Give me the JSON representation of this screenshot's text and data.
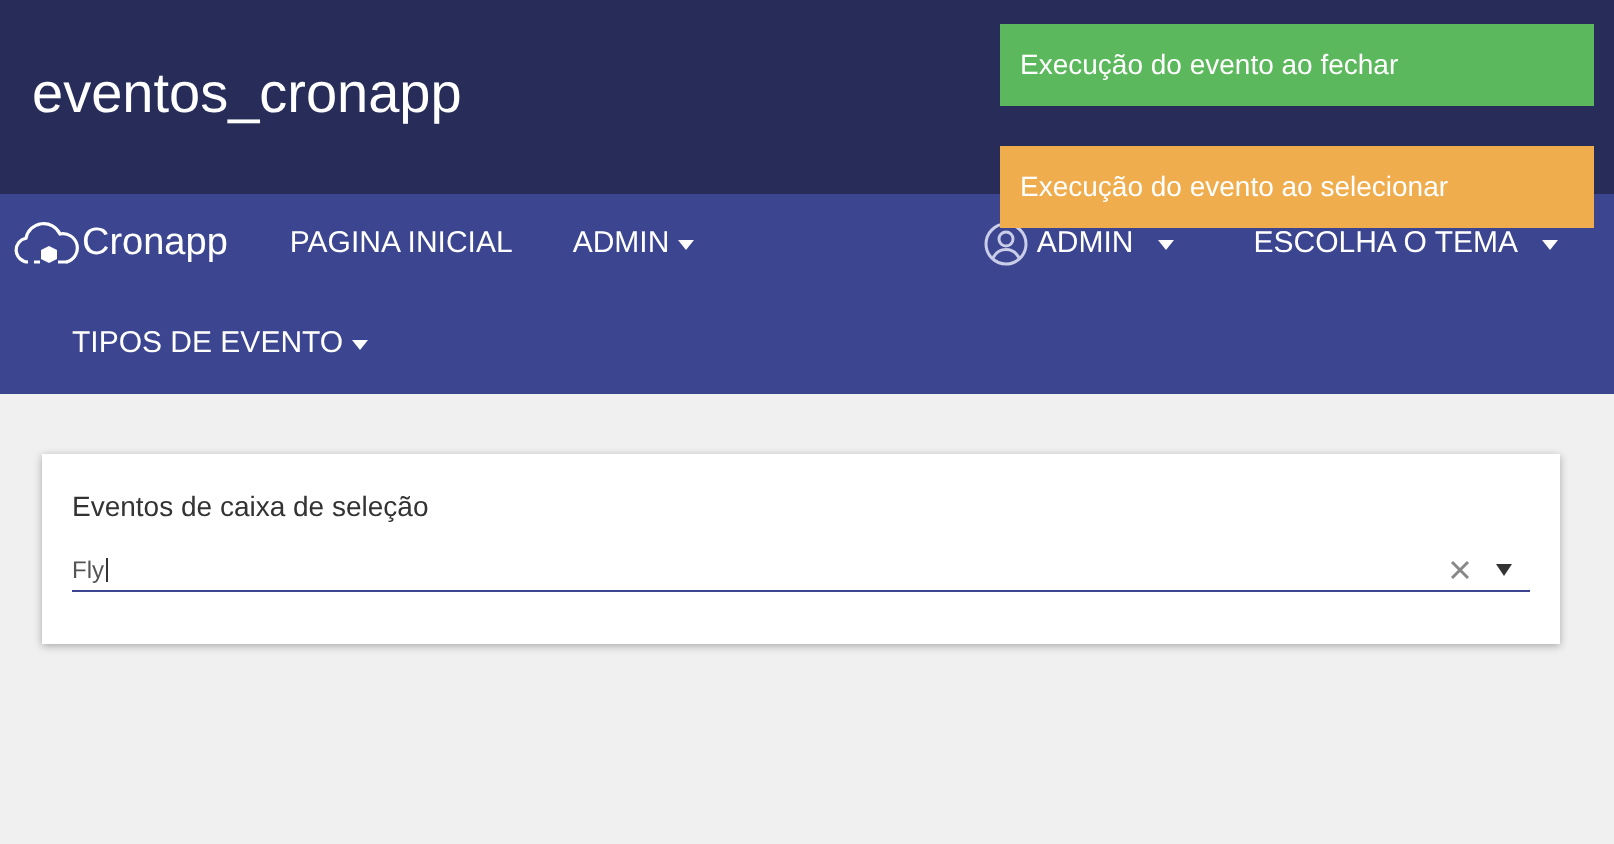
{
  "header": {
    "title": "eventos_cronapp"
  },
  "navbar": {
    "brand": "Cronapp",
    "items": [
      {
        "label": "PAGINA INICIAL",
        "dropdown": false
      },
      {
        "label": "ADMIN",
        "dropdown": true
      }
    ],
    "right_items": [
      {
        "label": "ADMIN",
        "dropdown": true,
        "kind": "user"
      },
      {
        "label": "ESCOLHA O TEMA",
        "dropdown": true,
        "kind": "plain"
      }
    ],
    "second_row": [
      {
        "label": "TIPOS DE EVENTO",
        "dropdown": true
      }
    ]
  },
  "card": {
    "label": "Eventos de caixa de seleção",
    "value": "Fly"
  },
  "toasts": [
    {
      "text": "Execução do evento ao fechar",
      "kind": "success"
    },
    {
      "text": "Execução do evento ao selecionar",
      "kind": "warning"
    }
  ]
}
